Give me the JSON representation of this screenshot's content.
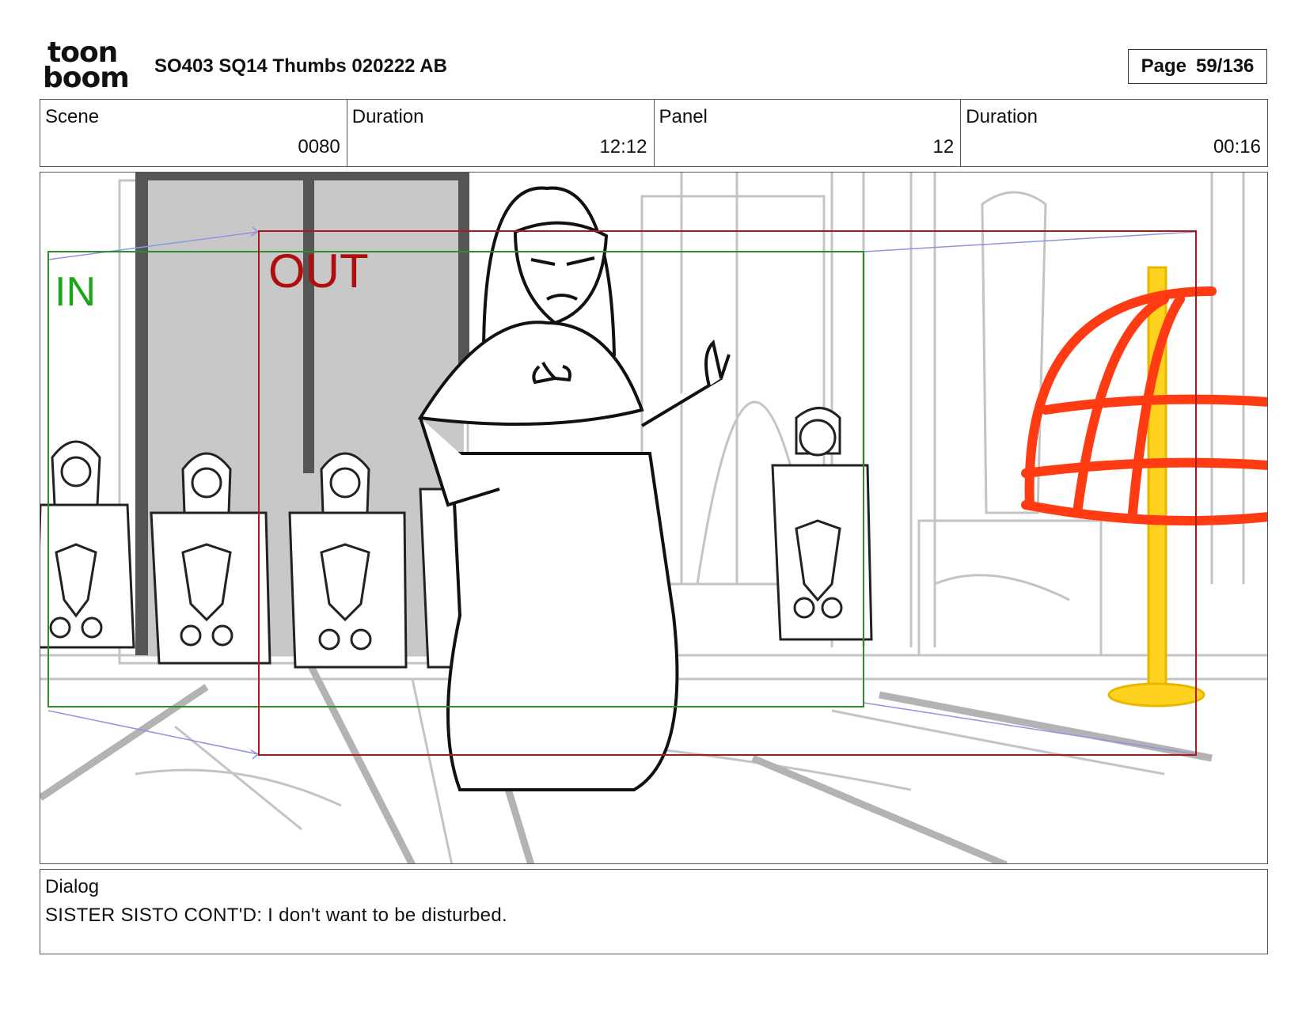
{
  "header": {
    "logo_line1": "toon",
    "logo_line2": "boom",
    "title": "SO403 SQ14 Thumbs 020222 AB",
    "page_label": "Page",
    "page_value": "59/136"
  },
  "info": [
    {
      "label": "Scene",
      "value": "0080"
    },
    {
      "label": "Duration",
      "value": "12:12"
    },
    {
      "label": "Panel",
      "value": "12"
    },
    {
      "label": "Duration",
      "value": "00:16"
    }
  ],
  "panel": {
    "in_label": "IN",
    "out_label": "OUT",
    "colors": {
      "in_frame": "#2e8b2e",
      "out_frame": "#b01818",
      "in_text": "#1aa51a",
      "out_text": "#b00d0d",
      "cage": "#ff3b14",
      "pole": "#ffd21f",
      "door": "#c8c8c8",
      "motion_arrow": "#8e94dd"
    }
  },
  "dialog": {
    "label": "Dialog",
    "text": "SISTER SISTO CONT'D: I don't want to be disturbed."
  }
}
